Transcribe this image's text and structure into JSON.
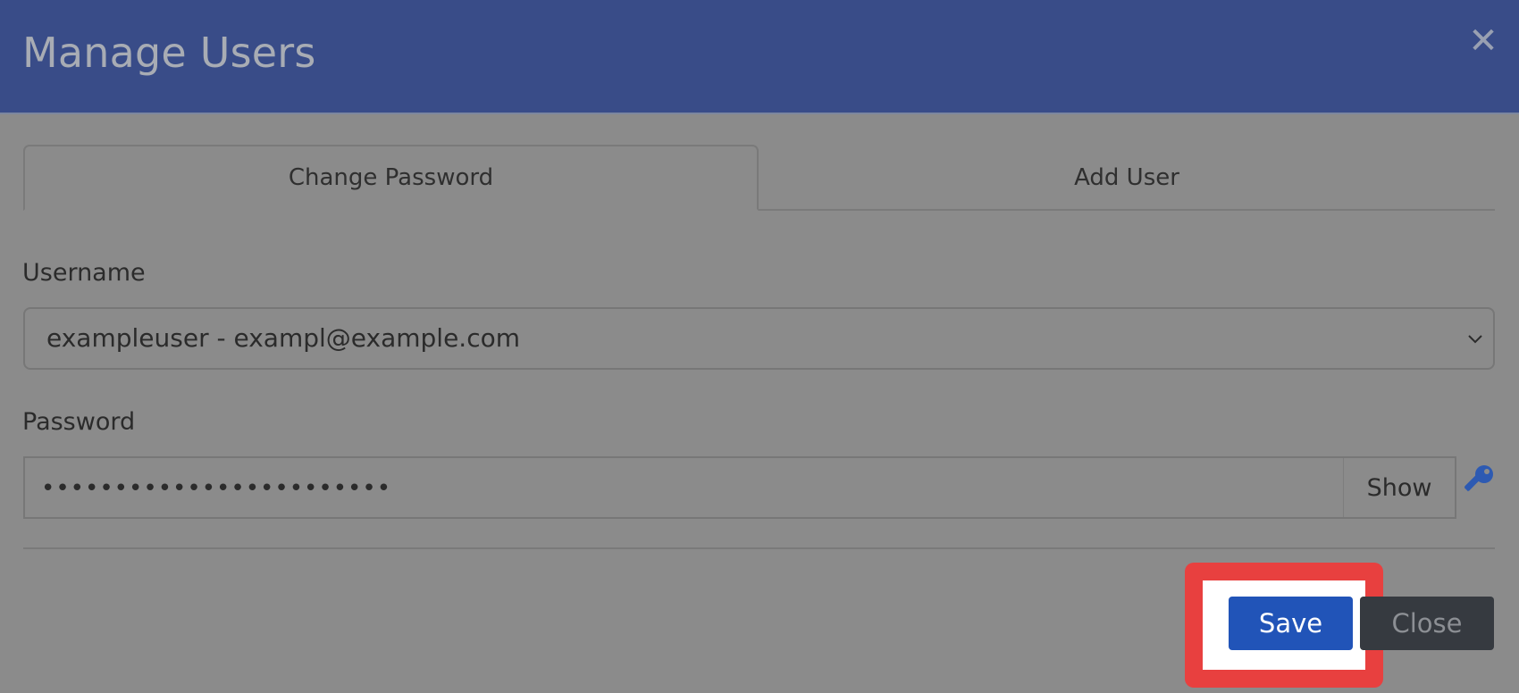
{
  "modal": {
    "title": "Manage Users",
    "close_icon": "close-icon"
  },
  "tabs": [
    {
      "label": "Change Password",
      "active": true
    },
    {
      "label": "Add User",
      "active": false
    }
  ],
  "form": {
    "username_label": "Username",
    "username_value": "exampleuser - exampl@example.com",
    "password_label": "Password",
    "password_value": "••••••••••••••••••••••••",
    "show_label": "Show",
    "generate_icon": "key-icon"
  },
  "footer": {
    "save_label": "Save",
    "close_label": "Close"
  },
  "colors": {
    "header": "#394c88",
    "primary": "#2154b8",
    "secondary": "#363a40",
    "highlight": "#e8403f",
    "overlay": "#8b8b8b"
  }
}
